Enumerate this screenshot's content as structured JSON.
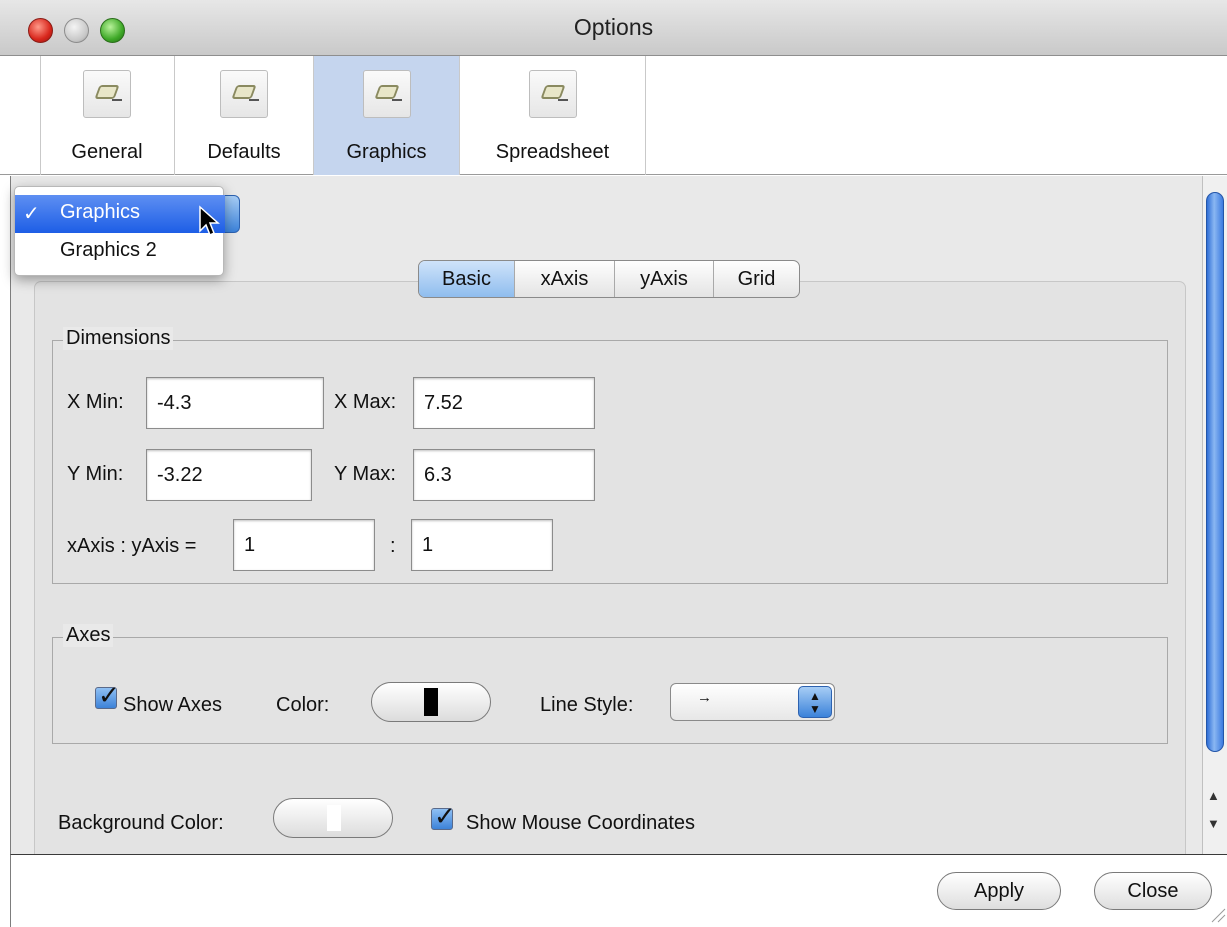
{
  "window": {
    "title": "Options"
  },
  "toolbar": {
    "items": [
      {
        "label": "General",
        "icon": "preferences-icon"
      },
      {
        "label": "Defaults",
        "icon": "preferences-icon"
      },
      {
        "label": "Graphics",
        "icon": "preferences-icon",
        "selected": true
      },
      {
        "label": "Spreadsheet",
        "icon": "preferences-icon"
      }
    ]
  },
  "view_menu": {
    "selected": "Graphics",
    "options": [
      "Graphics",
      "Graphics 2"
    ],
    "check": "✓"
  },
  "tabs": {
    "items": [
      "Basic",
      "xAxis",
      "yAxis",
      "Grid"
    ],
    "active": "Basic"
  },
  "dimensions": {
    "title": "Dimensions",
    "x_min_label": "X Min:",
    "x_min": "-4.3",
    "x_max_label": "X Max:",
    "x_max": "7.52",
    "y_min_label": "Y Min:",
    "y_min": "-3.22",
    "y_max_label": "Y Max:",
    "y_max": "6.3",
    "ratio_label": "xAxis : yAxis =",
    "ratio_x": "1",
    "ratio_sep": ":",
    "ratio_y": "1"
  },
  "axes": {
    "title": "Axes",
    "show_axes_label": "Show Axes",
    "show_axes": true,
    "color_label": "Color:",
    "color": "#000000",
    "line_style_label": "Line Style:",
    "line_style": "→"
  },
  "background": {
    "label": "Background Color:",
    "color": "#ffffff",
    "show_mouse_label": "Show Mouse Coordinates",
    "show_mouse": true
  },
  "buttons": {
    "apply": "Apply",
    "close": "Close"
  }
}
